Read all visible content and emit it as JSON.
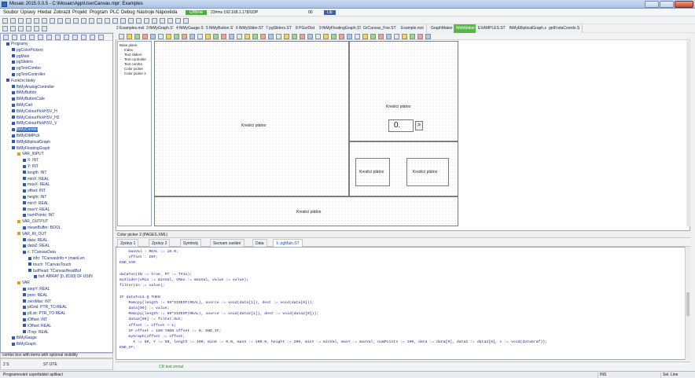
{
  "window": {
    "title": "Mosaic 2015.0.0.5 - C:\\Mosaic\\App\\UserCanvas.mpr: Examples"
  },
  "menu": [
    "Soubor",
    "Úpravy",
    "Hledat",
    "Zobrazit",
    "Projekt",
    "Program",
    "PLC",
    "Debug",
    "Nástroje",
    "Nápověda"
  ],
  "toolbar": {
    "online_badge": "Offline",
    "comm": "23#ms 192.168.1.178/UDP",
    "counter": "00",
    "lib_badge": "Lib"
  },
  "tabs": [
    {
      "label": "2 Examples.mxl"
    },
    {
      "label": "3 fbMyGraph.ST"
    },
    {
      "label": "4 fbMyGauge.ST"
    },
    {
      "label": "5 fbMyButton.ST"
    },
    {
      "label": "6 fbMySlider.ST"
    },
    {
      "label": "7 pgSliders.ST"
    },
    {
      "label": "8 PGsrDist"
    },
    {
      "label": "9 fbMyFloatingGraph.ST"
    },
    {
      "label": "GrCanvas_Fne.ST"
    },
    {
      "label": "Example.mxl"
    },
    {
      "label": "GraphMaker"
    },
    {
      "label": "WebMaker"
    },
    {
      "label": "EXAMPLES.ST"
    },
    {
      "label": "fbMyEllipticalGraph.st"
    },
    {
      "label": "getFrstaCoordx.S"
    }
  ],
  "tree": [
    "Programy",
    "pgColorPickers",
    "pgMain",
    "pgSliders",
    "pgTextCombo",
    "pgTextController",
    "Funkční bloky",
    "fbMyAnalogController",
    "fbMyButton",
    "fbMyButtonCafe",
    "fbMyCart",
    "fbMyColourPickHSV_H",
    "fbMyColourPickHSV_H2",
    "fbMyColourPickHSV_V",
    "fbMyCombo",
    "fbMyDIMPick",
    "fbMyEllipticalGraph",
    "fbMyFloatingGraph",
    "VAR_INPUT",
    "X: INT",
    "Y: INT",
    "length: INT",
    "minX: REAL",
    "maxX: REAL",
    "offset: INT",
    "height: INT",
    "minY: REAL",
    "maxY: REAL",
    "numPoints: INT",
    "VAR_OUTPUT",
    "meanBuffer: BOOL",
    "VAR_IN_OUT",
    "data: REAL",
    "data2: REAL",
    "c: TCanvasData",
    "info: TCanvasInfo = (mainLen",
    "touch: TCanvasTouch",
    "bufHead: TCanvasHeadBuf",
    "buf: ARRAY [0..8190] OF USIN",
    "VAR",
    "stepY: REAL",
    "pom: REAL",
    "zeroMax: INT",
    "plGrid: PTR_TO REAL",
    "plList: PTR_TO REAL",
    "iOffset: INT",
    "iOffset: REAL",
    "iTmp: REAL",
    "fbMyGauge",
    "fbMyGraph"
  ],
  "tree_status": "combo box with items with optional visibility",
  "left_bottom": {
    "left": "2  S",
    "mid": "ST UTE"
  },
  "pagelist": [
    "Base plane",
    "Index",
    "Text sliders",
    "Text controller",
    "Text combo",
    "Color picker",
    "Color picker 2"
  ],
  "canvas": {
    "main_label": "Kreslicí plátno",
    "right_top_label": "Kreslicí plátno",
    "value": "0.",
    "arrow": ">",
    "small1": "Kreslicí plátno",
    "small2": "Kreslicí plátno",
    "bottom_label": "Kreslicí plátno"
  },
  "pages_label": "Color picker 2 (PAGES.XML)",
  "editor_tabs": [
    "Zprávy 1",
    "Zprávy 2",
    "Symboly",
    "Seznam zaslání",
    "Data",
    "1: pgMain.ST"
  ],
  "code": [
    "    maxVal : REAL := 10.0;",
    "    offset : INT;",
    "END_VAR",
    "",
    "dataTon(IN := true, PT := T#1s);",
    "mySlider(vMin := minVal, vMax := maxVal, value := value);",
    "filter(In := value);",
    "",
    "IF dataTon1.Q THEN",
    "    Memcpy(length := 99*SIZEOF(REAL), source := void(data[1]), dest := void(data[0]));",
    "    data[99] := value;",
    "    Memcpy(length := 99*SIZEOF(REAL), source := void(data2[1]), dest := void(data2[0]));",
    "    data2[99] := filter.Out;",
    "    offset := offset + 1;",
    "    IF offset = 100 THEN offset := 0; END_IF;",
    "    myGraph(offset := offset,",
    "      X := 50, Y := 50, length := 400, minX := 0.0, maxX := 100.0, height := 200, minY := minVal, maxY := maxVal, numPoints := 100, data := data[0], data2 := data2[0], c := void(dataGraf));",
    "END_IF;"
  ],
  "ed_status": "CR text vmnul",
  "status": {
    "left": "Programování uspořádání aplikací",
    "ins": "INS",
    "mode": "Sel. Line"
  }
}
